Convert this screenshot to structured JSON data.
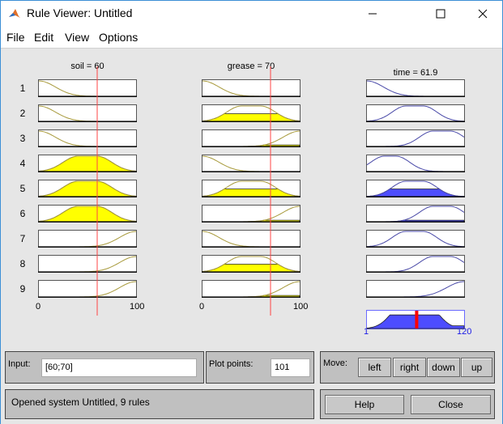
{
  "window": {
    "title": "Rule Viewer: Untitled",
    "controls": [
      "minimize",
      "maximize",
      "close"
    ]
  },
  "menu": [
    "File",
    "Edit",
    "View",
    "Options"
  ],
  "colors": {
    "input_mf_line": "#a89a3c",
    "input_fill": "#ffff00",
    "output_mf_line": "#4a4aa8",
    "output_fill": "#4d4dff",
    "input_marker": "#ff4444",
    "output_marker": "#ff0000",
    "axis_blue": "#1a1ae6"
  },
  "inputs": [
    {
      "name": "soil",
      "title": "soil = 60",
      "value": 60,
      "range": [
        0,
        100
      ],
      "range_labels": [
        "0",
        "100"
      ],
      "rules": [
        {
          "mf": "z",
          "firing": 0
        },
        {
          "mf": "z",
          "firing": 0
        },
        {
          "mf": "z",
          "firing": 0
        },
        {
          "mf": "gauss_mid",
          "firing": 1
        },
        {
          "mf": "gauss_mid",
          "firing": 1
        },
        {
          "mf": "gauss_mid",
          "firing": 1
        },
        {
          "mf": "s",
          "firing": 0
        },
        {
          "mf": "s",
          "firing": 0
        },
        {
          "mf": "s",
          "firing": 0
        }
      ]
    },
    {
      "name": "grease",
      "title": "grease = 70",
      "value": 70,
      "range": [
        0,
        100
      ],
      "range_labels": [
        "0",
        "100"
      ],
      "rules": [
        {
          "mf": "z",
          "firing": 0
        },
        {
          "mf": "gauss_mid",
          "firing": 0.5
        },
        {
          "mf": "s",
          "firing": 0.1
        },
        {
          "mf": "z",
          "firing": 0
        },
        {
          "mf": "gauss_mid",
          "firing": 0.5
        },
        {
          "mf": "s",
          "firing": 0.1
        },
        {
          "mf": "z",
          "firing": 0
        },
        {
          "mf": "gauss_mid",
          "firing": 0.5
        },
        {
          "mf": "s",
          "firing": 0.1
        }
      ]
    }
  ],
  "output": {
    "name": "time",
    "title": "time = 61.9",
    "value": 61.9,
    "range": [
      1,
      120
    ],
    "range_labels": [
      "1",
      "120"
    ],
    "rules": [
      {
        "mf": "very_short",
        "firing": 0
      },
      {
        "mf": "medium",
        "firing": 0
      },
      {
        "mf": "long",
        "firing": 0
      },
      {
        "mf": "short",
        "firing": 0
      },
      {
        "mf": "medium",
        "firing": 0.5
      },
      {
        "mf": "long",
        "firing": 0.1
      },
      {
        "mf": "medium",
        "firing": 0
      },
      {
        "mf": "long",
        "firing": 0
      },
      {
        "mf": "very_long",
        "firing": 0
      }
    ]
  },
  "rule_numbers": [
    "1",
    "2",
    "3",
    "4",
    "5",
    "6",
    "7",
    "8",
    "9"
  ],
  "controls": {
    "input_label": "Input:",
    "input_value": "[60;70]",
    "plot_points_label": "Plot points:",
    "plot_points_value": "101",
    "move_label": "Move:",
    "move_buttons": [
      "left",
      "right",
      "down",
      "up"
    ],
    "status": "Opened system Untitled, 9 rules",
    "help_label": "Help",
    "close_label": "Close"
  }
}
